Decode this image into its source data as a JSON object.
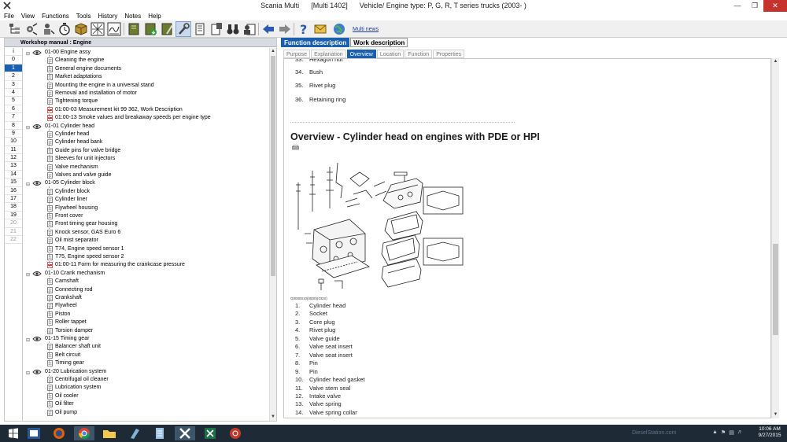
{
  "window": {
    "title_app": "Scania Multi",
    "title_build": "[Multi 1402]",
    "title_vehicle": "Vehicle/ Engine type: P, G, R, T series trucks (2003- )"
  },
  "menu": [
    "File",
    "View",
    "Functions",
    "Tools",
    "History",
    "Notes",
    "Help"
  ],
  "toolbar": {
    "multi_news": "Multi news"
  },
  "left_panel": {
    "header": "Workshop manual : Engine",
    "chapters": [
      "i",
      "0",
      "1",
      "2",
      "3",
      "4",
      "5",
      "6",
      "7",
      "8",
      "9",
      "10",
      "11",
      "12",
      "13",
      "14",
      "15",
      "16",
      "17",
      "18",
      "19",
      "20",
      "21",
      "22"
    ],
    "selected_chapter": "1",
    "tree": [
      {
        "type": "group",
        "text": "01-00 Engine assy"
      },
      {
        "type": "item",
        "icon": "doc",
        "text": "Cleaning the engine"
      },
      {
        "type": "item",
        "icon": "doc",
        "text": "General engine documents"
      },
      {
        "type": "item",
        "icon": "doc",
        "text": "Market adaptations"
      },
      {
        "type": "item",
        "icon": "doc",
        "text": "Mounting the engine in a universal stand"
      },
      {
        "type": "item",
        "icon": "doc",
        "text": "Removal and installation of motor"
      },
      {
        "type": "item",
        "icon": "doc",
        "text": "Tightening torque"
      },
      {
        "type": "item",
        "icon": "pdf",
        "text": "01:00-03 Measurement kit 99 362, Work Description"
      },
      {
        "type": "item",
        "icon": "pdf",
        "text": "01:00-13 Smoke values and breakaway speeds per engine type"
      },
      {
        "type": "group",
        "text": "01-01 Cylinder head"
      },
      {
        "type": "item",
        "icon": "doc",
        "text": "Cylinder head"
      },
      {
        "type": "item",
        "icon": "doc",
        "text": "Cylinder head bank"
      },
      {
        "type": "item",
        "icon": "doc",
        "text": "Guide pins for valve bridge"
      },
      {
        "type": "item",
        "icon": "doc",
        "text": "Sleeves for unit injectors"
      },
      {
        "type": "item",
        "icon": "doc",
        "text": "Valve mechanism"
      },
      {
        "type": "item",
        "icon": "doc",
        "text": "Valves and valve guide"
      },
      {
        "type": "group",
        "text": "01-05 Cylinder block"
      },
      {
        "type": "item",
        "icon": "doc",
        "text": "Cylinder block"
      },
      {
        "type": "item",
        "icon": "doc",
        "text": "Cylinder liner"
      },
      {
        "type": "item",
        "icon": "doc",
        "text": "Flywheel housing"
      },
      {
        "type": "item",
        "icon": "doc",
        "text": "Front cover"
      },
      {
        "type": "item",
        "icon": "doc",
        "text": "Front timing gear housing"
      },
      {
        "type": "item",
        "icon": "doc",
        "text": "Knock sensor, GAS Euro 6"
      },
      {
        "type": "item",
        "icon": "doc",
        "text": "Oil mist separator"
      },
      {
        "type": "item",
        "icon": "doc",
        "text": "T74, Engine speed sensor 1"
      },
      {
        "type": "item",
        "icon": "doc",
        "text": "T75, Engine speed sensor 2"
      },
      {
        "type": "item",
        "icon": "pdf",
        "text": "01:00-11 Form for measuring the crankcase pressure"
      },
      {
        "type": "group",
        "text": "01-10 Crank mechanism"
      },
      {
        "type": "item",
        "icon": "doc",
        "text": "Camshaft"
      },
      {
        "type": "item",
        "icon": "doc",
        "text": "Connecting rod"
      },
      {
        "type": "item",
        "icon": "doc",
        "text": "Crankshaft"
      },
      {
        "type": "item",
        "icon": "doc",
        "text": "Flywheel"
      },
      {
        "type": "item",
        "icon": "doc",
        "text": "Piston"
      },
      {
        "type": "item",
        "icon": "doc",
        "text": "Roller tappet"
      },
      {
        "type": "item",
        "icon": "doc",
        "text": "Torsion damper"
      },
      {
        "type": "group",
        "text": "01-15 Timing gear"
      },
      {
        "type": "item",
        "icon": "doc",
        "text": "Balancer shaft unit"
      },
      {
        "type": "item",
        "icon": "doc",
        "text": "Belt circuit"
      },
      {
        "type": "item",
        "icon": "doc",
        "text": "Timing gear"
      },
      {
        "type": "group",
        "text": "01-20 Lubrication system"
      },
      {
        "type": "item",
        "icon": "doc",
        "text": "Centrifugal oil cleaner"
      },
      {
        "type": "item",
        "icon": "doc",
        "text": "Lubrication system"
      },
      {
        "type": "item",
        "icon": "doc",
        "text": "Oil cooler"
      },
      {
        "type": "item",
        "icon": "doc",
        "text": "Oil filter"
      },
      {
        "type": "item",
        "icon": "doc",
        "text": "Oil pump"
      }
    ]
  },
  "right_panel": {
    "main_tabs": [
      "Function description",
      "Work description"
    ],
    "main_active": 0,
    "sub_tabs": [
      "Purpose",
      "Explanation",
      "Overview",
      "Location",
      "Function",
      "Properties"
    ],
    "sub_active": 2,
    "top_parts": [
      {
        "n": "33.",
        "t": "Hexagon nut"
      },
      {
        "n": "34.",
        "t": "Bush"
      },
      {
        "n": "35.",
        "t": "Rivet plug"
      },
      {
        "n": "36.",
        "t": "Retaining ring"
      }
    ],
    "heading": "Overview - Cylinder head on engines with PDE or HPI",
    "figure_caption": "G0000010(0500)(GDS)",
    "parts": [
      {
        "n": "1.",
        "t": "Cylinder head"
      },
      {
        "n": "2.",
        "t": "Socket"
      },
      {
        "n": "3.",
        "t": "Core plug"
      },
      {
        "n": "4.",
        "t": "Rivet plug"
      },
      {
        "n": "5.",
        "t": "Valve guide"
      },
      {
        "n": "6.",
        "t": "Valve seat insert"
      },
      {
        "n": "7.",
        "t": "Valve seat insert"
      },
      {
        "n": "8.",
        "t": "Pin"
      },
      {
        "n": "9.",
        "t": "Pin"
      },
      {
        "n": "10.",
        "t": "Cylinder head gasket"
      },
      {
        "n": "11.",
        "t": "Valve stem seal"
      },
      {
        "n": "12.",
        "t": "Intake valve"
      },
      {
        "n": "13.",
        "t": "Valve spring"
      },
      {
        "n": "14.",
        "t": "Valve spring collar"
      }
    ]
  },
  "taskbar": {
    "watermark": "DieselStation.com",
    "time": "10:06 AM",
    "date": "9/27/2015"
  }
}
